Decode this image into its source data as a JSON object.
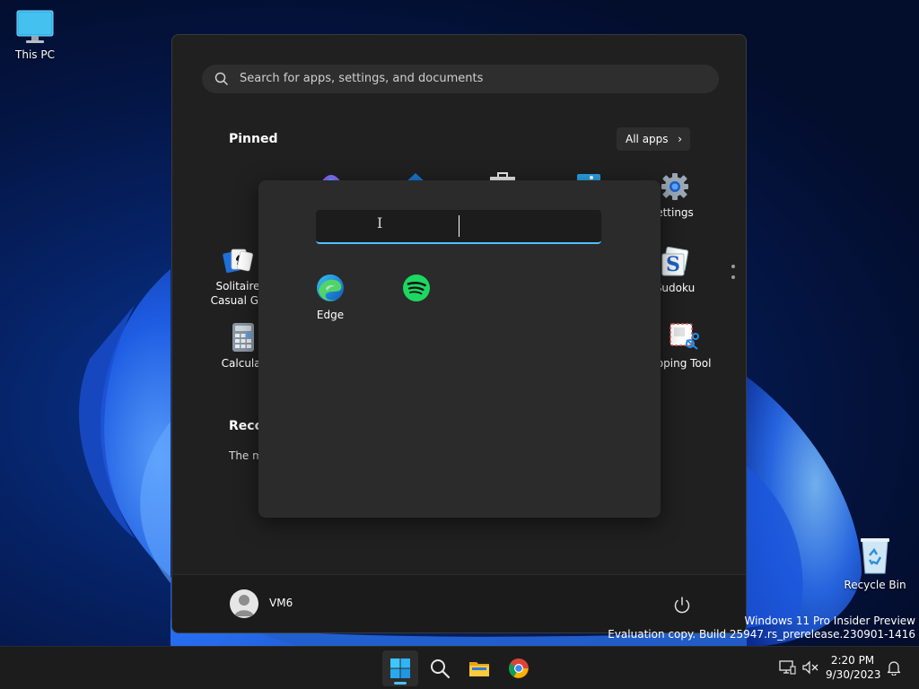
{
  "desktop": {
    "this_pc_label": "This PC",
    "recycle_bin_label": "Recycle Bin"
  },
  "start_menu": {
    "search_placeholder": "Search for apps, settings, and documents",
    "pinned_title": "Pinned",
    "all_apps_label": "All apps",
    "recommended_title": "Recor",
    "recommended_text": "The m",
    "pinned_visible": [
      {
        "label_line1": "Solitaire",
        "label_line2": "Casual Ga"
      },
      {
        "label_line1": "Calculat",
        "label_line2": ""
      },
      {
        "label_line1": "ettings",
        "label_line2": ""
      },
      {
        "label_line1": "Sudoku",
        "label_line2": ""
      },
      {
        "label_line1": "pping Tool",
        "label_line2": ""
      }
    ],
    "folder": {
      "name_value": "",
      "apps": [
        {
          "label": "Edge",
          "icon": "edge-icon"
        },
        {
          "label": "",
          "icon": "spotify-icon"
        }
      ]
    },
    "user_name": "VM6"
  },
  "watermark": {
    "line1": "Windows 11 Pro Insider Preview",
    "line2": "Evaluation copy. Build 25947.rs_prerelease.230901-1416"
  },
  "taskbar": {
    "time": "2:20 PM",
    "date": "9/30/2023",
    "accent": "#4cc2ff"
  }
}
